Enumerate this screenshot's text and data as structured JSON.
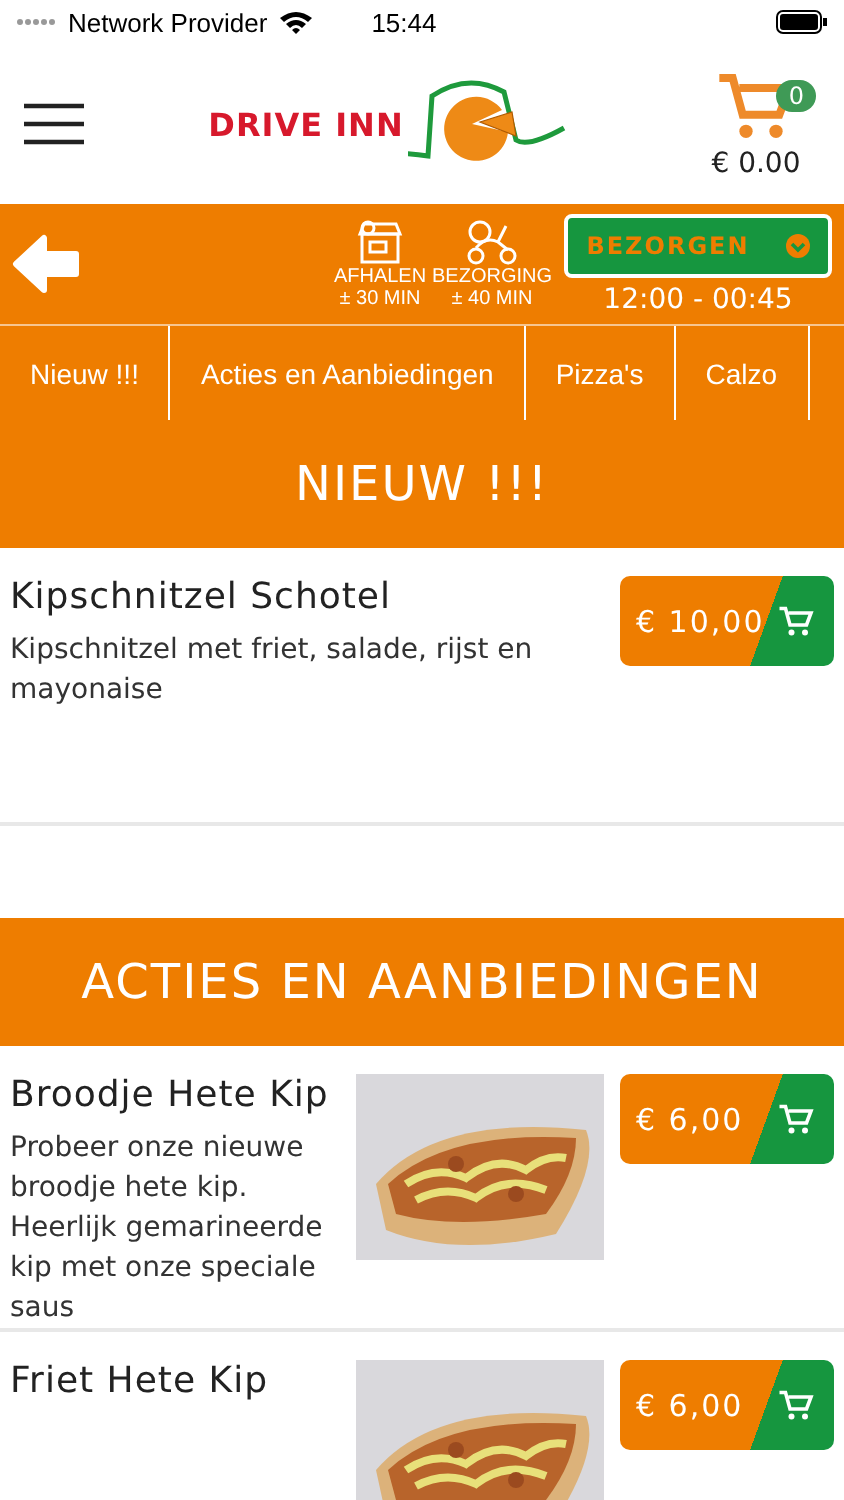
{
  "status_bar": {
    "carrier": "Network Provider",
    "time": "15:44"
  },
  "header": {
    "logo": "DRIVE INN",
    "cart": {
      "count": "0",
      "total": "€ 0.00"
    }
  },
  "order_bar": {
    "modes": [
      {
        "kind": "pickup",
        "label": "AFHALEN",
        "time": "± 30 MIN"
      },
      {
        "kind": "delivery",
        "label": "BEZORGING",
        "time": "± 40 MIN"
      }
    ],
    "dropdown": "BEZORGEN",
    "hours": "12:00 - 00:45"
  },
  "categories": [
    {
      "label": "Nieuw !!!",
      "selected": false
    },
    {
      "label": "Acties en Aanbiedingen",
      "selected": false
    },
    {
      "label": "Pizza's",
      "selected": false
    },
    {
      "label": "Calzo",
      "selected": false
    }
  ],
  "sections": [
    {
      "title": "NIEUW !!!",
      "items": [
        {
          "name": "Kipschnitzel Schotel",
          "description": "Kipschnitzel met friet, salade, rijst en mayonaise",
          "price": "€ 10,00",
          "has_picture": false
        }
      ]
    },
    {
      "title": "ACTIES EN AANBIEDINGEN",
      "items": [
        {
          "name": "Broodje Hete Kip",
          "description": "Probeer onze nieuwe broodje hete kip. Heerlijk gemarineerde kip met onze speciale saus",
          "price": "€ 6,00",
          "has_picture": true
        },
        {
          "name": "Friet Hete Kip",
          "price": "€ 6,00",
          "has_picture": true
        }
      ]
    }
  ]
}
